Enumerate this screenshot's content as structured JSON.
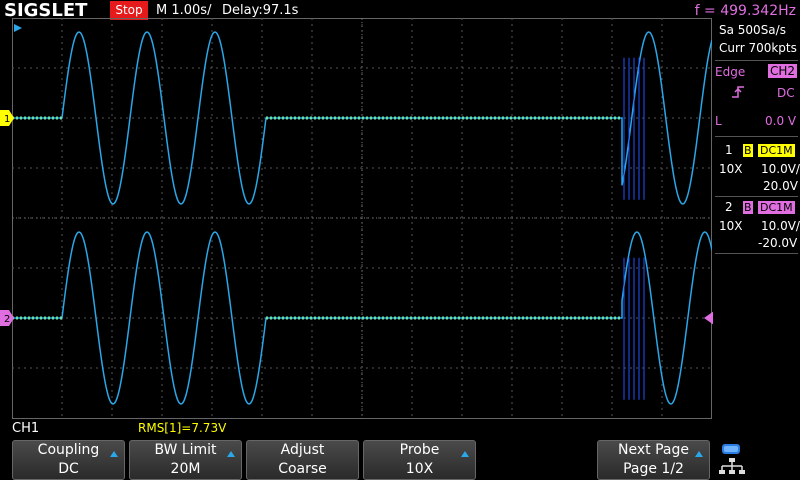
{
  "header": {
    "logo": "SIGSLET",
    "status": "Stop",
    "timebase": "M 1.00s/",
    "delay": "Delay:97.1s",
    "frequency": "f = 499.342Hz"
  },
  "acquisition": {
    "sample_rate": "Sa 500Sa/s",
    "memory_depth": "Curr 700kpts"
  },
  "trigger": {
    "type": "Edge",
    "source": "CH2",
    "slope_icon": "rising-edge-icon",
    "coupling": "DC",
    "level_label": "L",
    "level": "0.0 V"
  },
  "channels": [
    {
      "num": "1",
      "bw": "B",
      "coupling": "DC1M",
      "probe": "10X",
      "scale": "10.0V/",
      "offset": "20.0V",
      "color": "#ffff00"
    },
    {
      "num": "2",
      "bw": "B",
      "coupling": "DC1M",
      "probe": "10X",
      "scale": "10.0V/",
      "offset": "-20.0V",
      "color": "#e06ee0"
    }
  ],
  "markers": {
    "ch1": "1",
    "ch2": "2"
  },
  "bottom": {
    "channel": "CH1",
    "measurement": "RMS[1]=7.73V"
  },
  "menu": [
    {
      "line1": "Coupling",
      "line2": "DC",
      "arrow": true
    },
    {
      "line1": "BW Limit",
      "line2": "20M",
      "arrow": true
    },
    {
      "line1": "Adjust",
      "line2": "Coarse",
      "arrow": false
    },
    {
      "line1": "Probe",
      "line2": "10X",
      "arrow": true
    },
    {
      "line1": "Next Page",
      "line2": "Page 1/2",
      "arrow": true
    }
  ],
  "colors": {
    "ch1_trace": "#6be3a6",
    "ch2_trace": "#e06ee0",
    "trace_line": "#2aa7e8",
    "status_bg": "#e6191b"
  }
}
